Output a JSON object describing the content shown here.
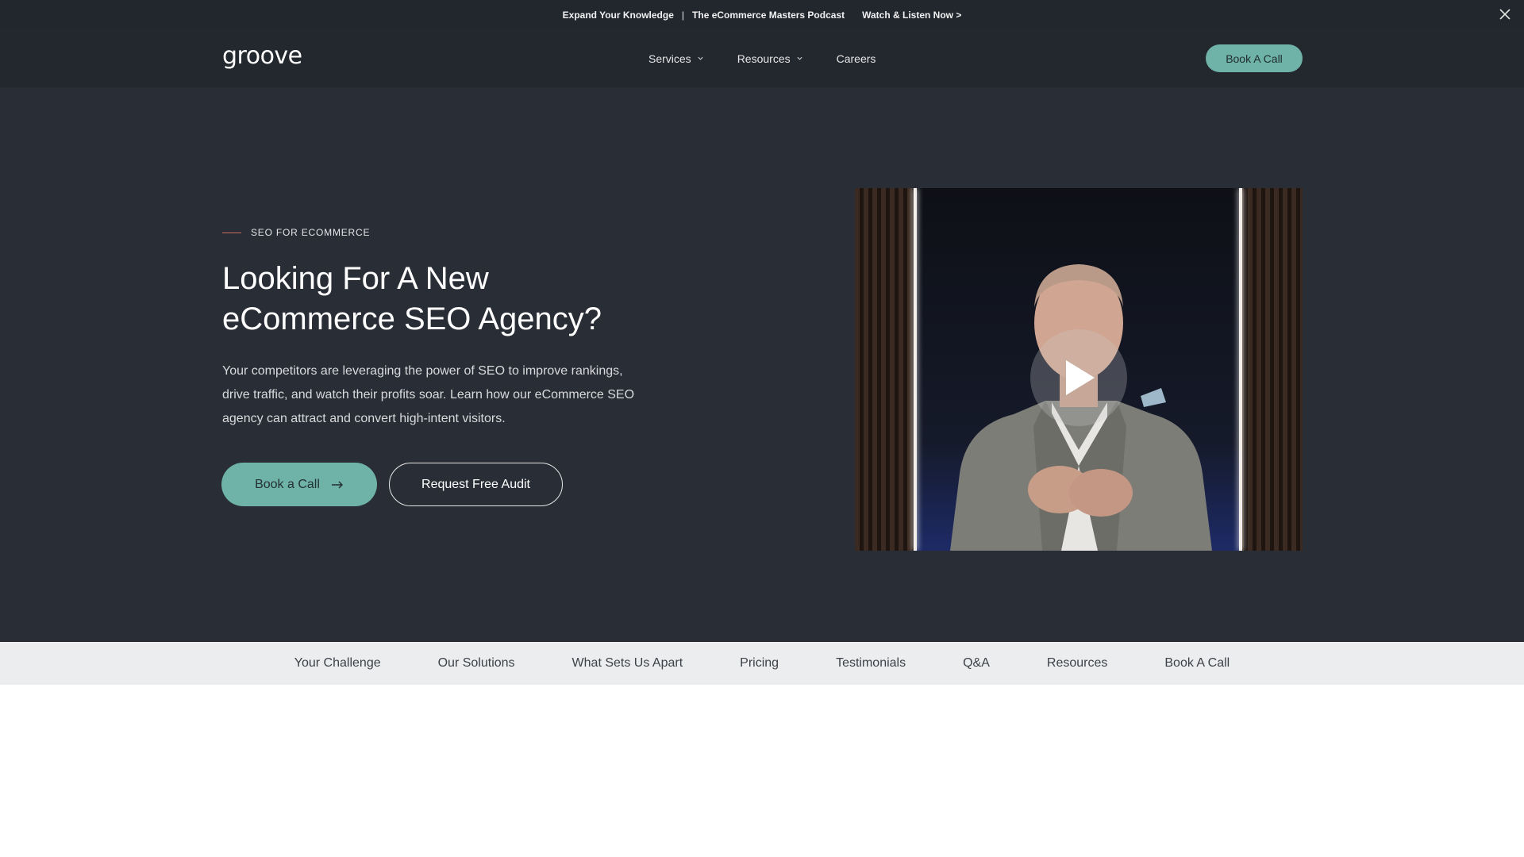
{
  "announcement": {
    "left": "Expand Your Knowledge",
    "separator": "|",
    "middle": "The eCommerce Masters Podcast",
    "cta": "Watch & Listen Now >"
  },
  "header": {
    "logo": "groove",
    "nav": [
      {
        "label": "Services",
        "has_dropdown": true
      },
      {
        "label": "Resources",
        "has_dropdown": true
      },
      {
        "label": "Careers",
        "has_dropdown": false
      }
    ],
    "cta": "Book A Call"
  },
  "hero": {
    "eyebrow": "SEO FOR ECOMMERCE",
    "title": "Looking For A New eCommerce SEO Agency?",
    "description": "Your competitors are leveraging the power of SEO to improve rankings, drive traffic, and watch their profits soar. Learn how our eCommerce SEO agency can attract and convert high-intent visitors.",
    "primary_button": "Book a Call",
    "secondary_button": "Request Free Audit"
  },
  "subnav": [
    "Your Challenge",
    "Our Solutions",
    "What Sets Us Apart",
    "Pricing",
    "Testimonials",
    "Q&A",
    "Resources",
    "Book A Call"
  ],
  "colors": {
    "accent": "#6fb3a8",
    "hero_bg": "#292d36",
    "header_bg": "#23272e",
    "eyebrow_dash": "#c96b5e"
  },
  "icons": {
    "close": "close-icon",
    "dropdown": "chevron-down-icon",
    "arrow": "arrow-right-icon",
    "play": "play-icon"
  }
}
